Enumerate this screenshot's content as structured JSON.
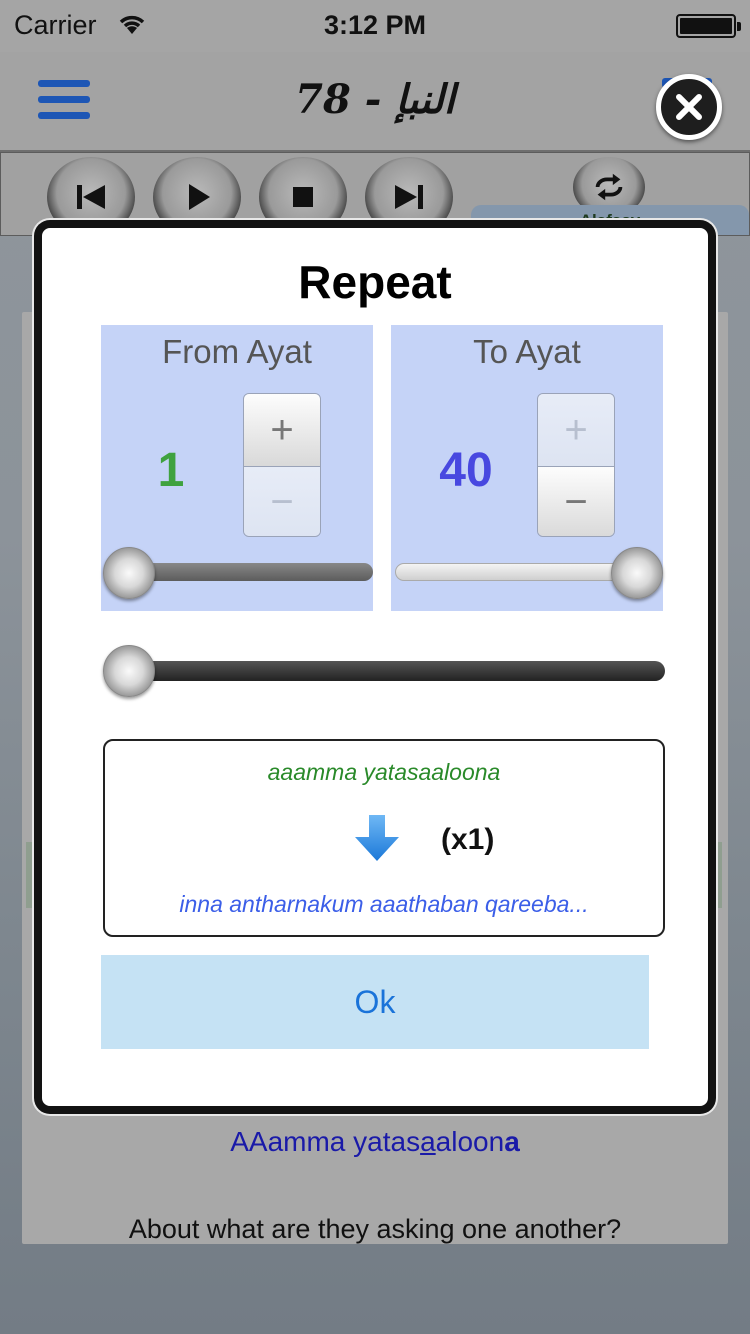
{
  "status_bar": {
    "carrier": "Carrier",
    "time": "3:12 PM"
  },
  "nav": {
    "title": "78 - النبإ"
  },
  "player": {
    "reciter": "Alafasy"
  },
  "background": {
    "translit_pre": "AAamma yatas",
    "translit_u": "a",
    "translit_mid": "aloon",
    "translit_b": "a",
    "translation": "About what are they asking one another?"
  },
  "modal": {
    "title": "Repeat",
    "from": {
      "label": "From Ayat",
      "value": "1",
      "plus": "+",
      "minus": "−",
      "slider_fraction": 0.0
    },
    "to": {
      "label": "To Ayat",
      "value": "40",
      "plus": "+",
      "minus": "−",
      "slider_fraction": 1.0
    },
    "repeat_slider_fraction": 0.0,
    "summary": {
      "from_text": "aaamma yatasaaloona",
      "count": "(x1)",
      "to_text": "inna antharnakum aaathaban qareeba..."
    },
    "ok": "Ok"
  },
  "colors": {
    "from_value": "#3fa23f",
    "to_value": "#4848e0",
    "panel_bg": "#c5d3f7",
    "ok_bg": "#c5e2f4",
    "ok_text": "#1a73d9"
  },
  "icons": {
    "menu": "menu-icon",
    "close": "close-icon",
    "previous": "skip-previous-icon",
    "play": "play-icon",
    "stop": "stop-icon",
    "next": "skip-next-icon",
    "repeat": "repeat-icon",
    "arrow": "arrow-down-icon"
  }
}
